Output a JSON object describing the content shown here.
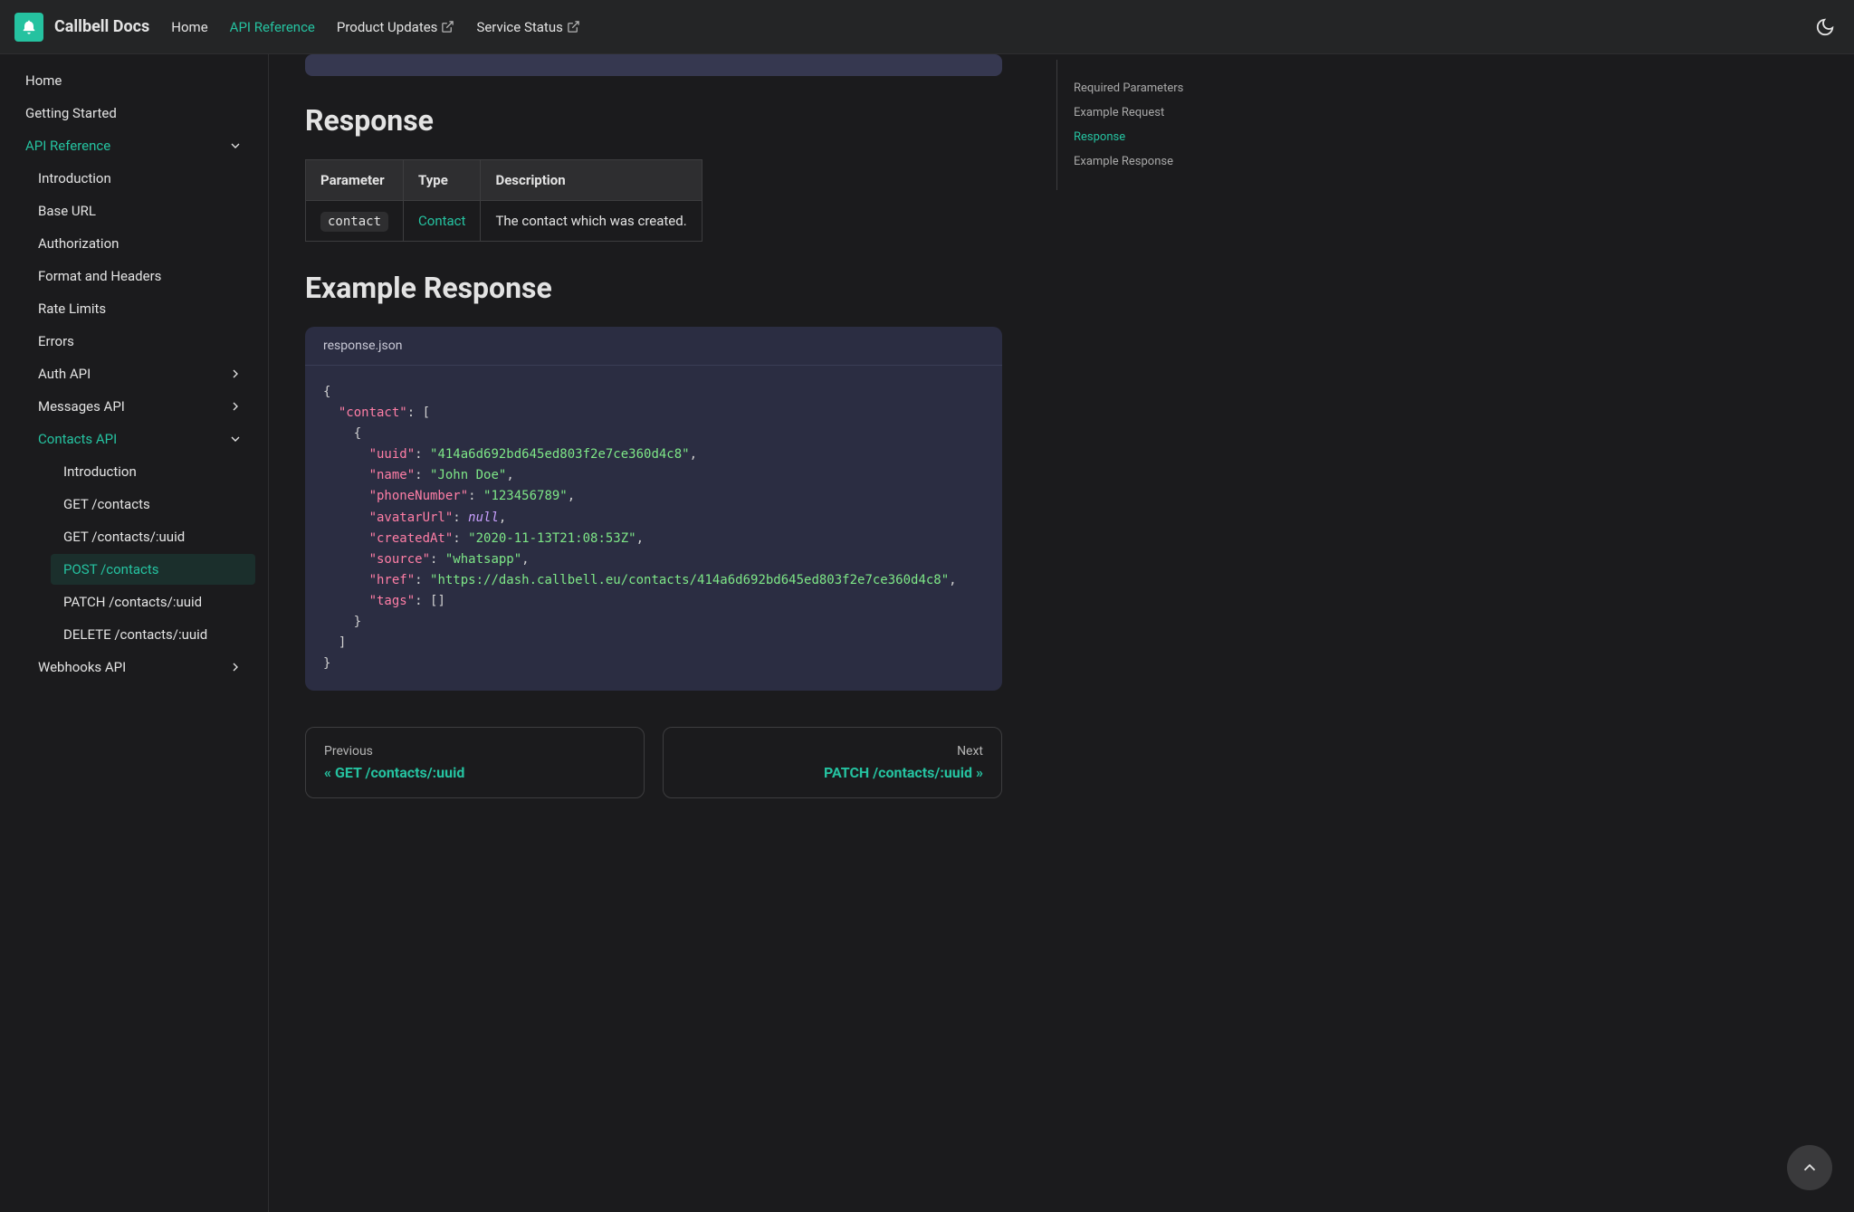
{
  "brand": "Callbell Docs",
  "nav": {
    "home": "Home",
    "api": "API Reference",
    "updates": "Product Updates",
    "status": "Service Status"
  },
  "sidebar": {
    "home": "Home",
    "getting_started": "Getting Started",
    "api_reference": "API Reference",
    "introduction": "Introduction",
    "base_url": "Base URL",
    "authorization": "Authorization",
    "format": "Format and Headers",
    "rate_limits": "Rate Limits",
    "errors": "Errors",
    "auth_api": "Auth API",
    "messages_api": "Messages API",
    "contacts_api": "Contacts API",
    "c_intro": "Introduction",
    "c_get": "GET /contacts",
    "c_get_uuid": "GET /contacts/:uuid",
    "c_post": "POST /contacts",
    "c_patch": "PATCH /contacts/:uuid",
    "c_delete": "DELETE /contacts/:uuid",
    "webhooks": "Webhooks API"
  },
  "headings": {
    "response": "Response",
    "example_response": "Example Response"
  },
  "table": {
    "h_param": "Parameter",
    "h_type": "Type",
    "h_desc": "Description",
    "r_param": "contact",
    "r_type": "Contact",
    "r_desc": "The contact which was created."
  },
  "code": {
    "filename": "response.json",
    "k_contact": "\"contact\"",
    "k_uuid": "\"uuid\"",
    "v_uuid": "\"414a6d692bd645ed803f2e7ce360d4c8\"",
    "k_name": "\"name\"",
    "v_name": "\"John Doe\"",
    "k_phone": "\"phoneNumber\"",
    "v_phone": "\"123456789\"",
    "k_avatar": "\"avatarUrl\"",
    "v_null": "null",
    "k_created": "\"createdAt\"",
    "v_created": "\"2020-11-13T21:08:53Z\"",
    "k_source": "\"source\"",
    "v_source": "\"whatsapp\"",
    "k_href": "\"href\"",
    "v_href": "\"https://dash.callbell.eu/contacts/414a6d692bd645ed803f2e7ce360d4c8\"",
    "k_tags": "\"tags\""
  },
  "pagenav": {
    "prev_label": "Previous",
    "prev_title": "« GET /contacts/:uuid",
    "next_label": "Next",
    "next_title": "PATCH /contacts/:uuid »"
  },
  "toc": {
    "required": "Required Parameters",
    "example_req": "Example Request",
    "response": "Response",
    "example_resp": "Example Response"
  }
}
